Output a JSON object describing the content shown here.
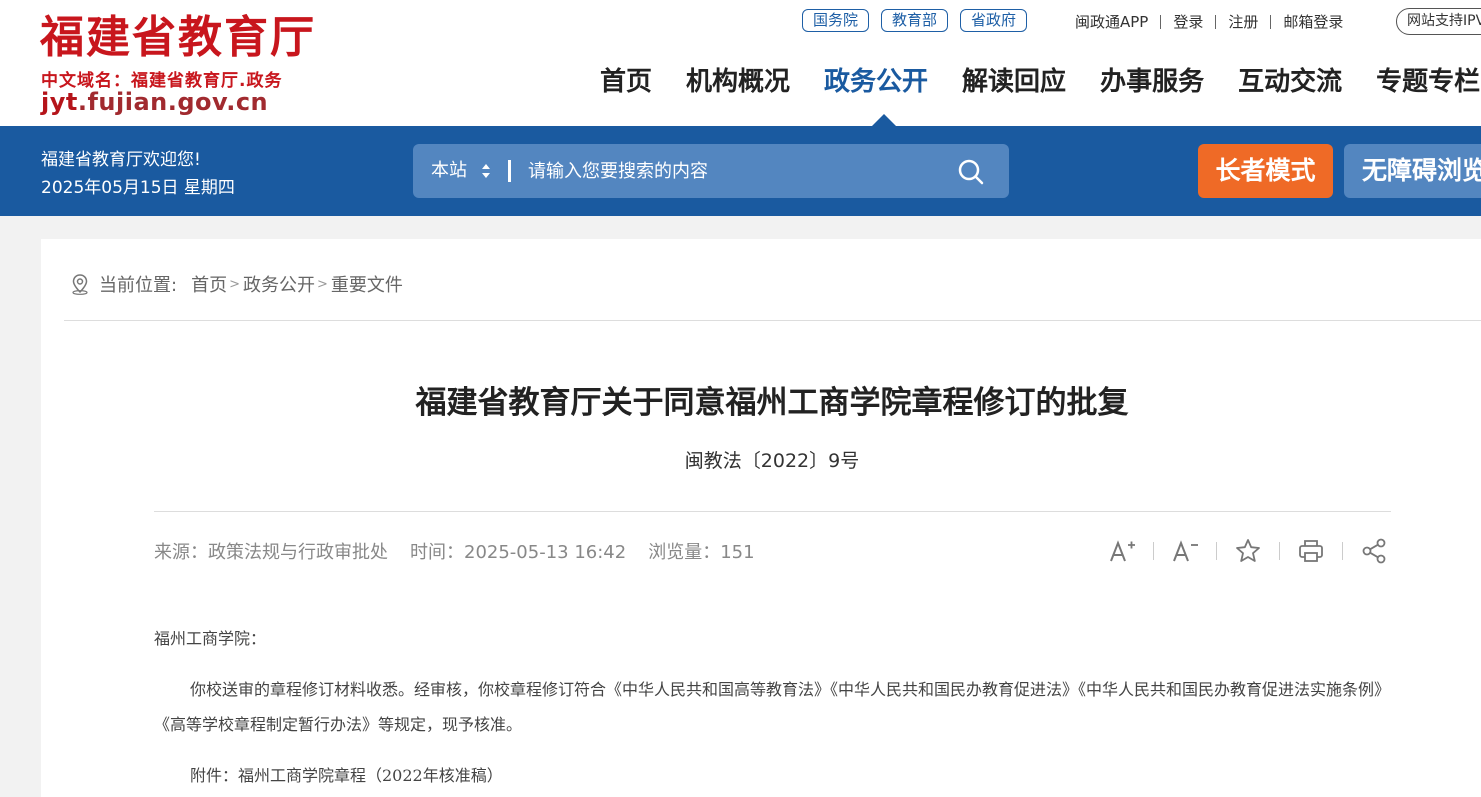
{
  "header": {
    "logo_title": "福建省教育厅",
    "logo_subtitle": "中文域名：福建省教育厅.政务",
    "logo_domain_a": "jyt",
    "logo_domain_b": ".fujian.gov.cn",
    "gov_links": [
      "国务院",
      "教育部",
      "省政府"
    ],
    "util_links": [
      "闽政通APP",
      "登录",
      "注册",
      "邮箱登录"
    ],
    "ipv6_badge": "网站支持IPV",
    "nav": [
      "首页",
      "机构概况",
      "政务公开",
      "解读回应",
      "办事服务",
      "互动交流",
      "专题专栏"
    ],
    "active_nav": "政务公开"
  },
  "band": {
    "welcome": "福建省教育厅欢迎您!",
    "date": "2025年05月15日 星期四",
    "search_scope": "本站",
    "search_placeholder": "请输入您要搜索的内容",
    "elder_mode": "长者模式",
    "accessible_mode": "无障碍浏览"
  },
  "breadcrumb": {
    "label": "当前位置:",
    "items": [
      "首页",
      "政务公开",
      "重要文件"
    ]
  },
  "article": {
    "title": "福建省教育厅关于同意福州工商学院章程修订的批复",
    "doc_number": "闽教法〔2022〕9号",
    "source": "来源：政策法规与行政审批处",
    "time": "时间：2025-05-13 16:42",
    "views": "浏览量：151",
    "tools": [
      "font-increase-icon",
      "font-decrease-icon",
      "star-icon",
      "print-icon",
      "share-icon"
    ],
    "salutation": "福州工商学院：",
    "paragraph1": "你校送审的章程修订材料收悉。经审核，你校章程修订符合《中华人民共和国高等教育法》《中华人民共和国民办教育促进法》《中华人民共和国民办教育促进法实施条例》《高等学校章程制定暂行办法》等规定，现予核准。",
    "attachment": "附件：福州工商学院章程（2022年核准稿）"
  },
  "colors": {
    "brand_red": "#c8161d",
    "brand_blue": "#1a5aa0",
    "search_bg": "#5386c0",
    "elder_orange": "#ef6a26"
  }
}
